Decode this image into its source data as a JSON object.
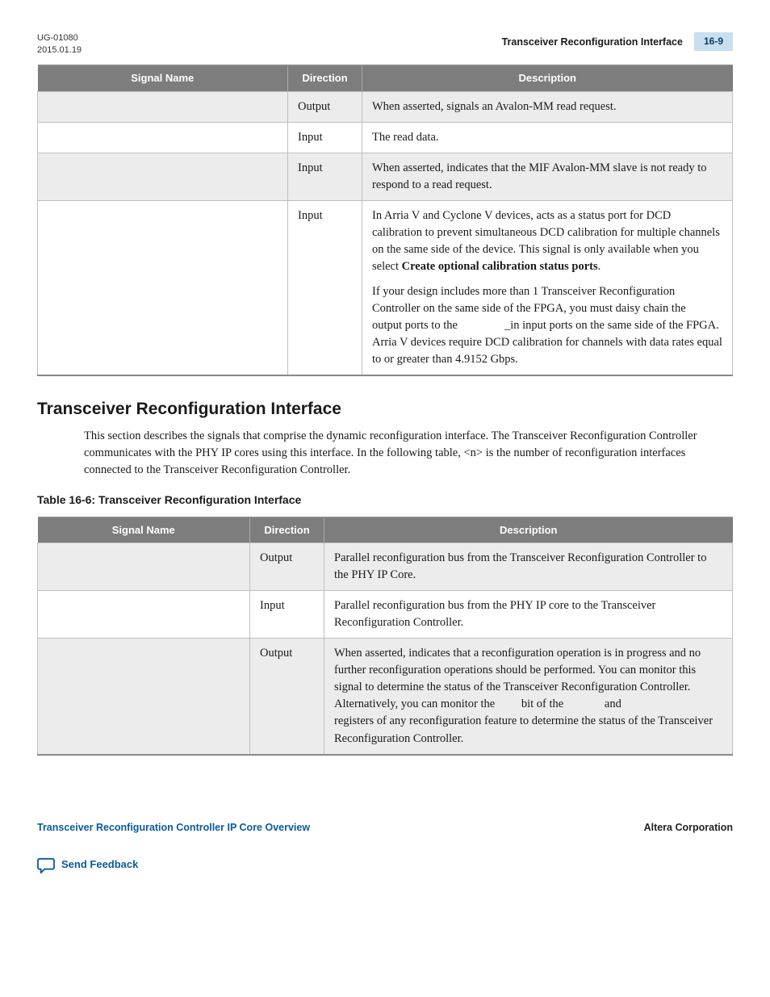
{
  "header": {
    "doc_id": "UG-01080",
    "date": "2015.01.19",
    "crumb": "Transceiver Reconfiguration Interface",
    "page": "16-9"
  },
  "table1": {
    "headers": [
      "Signal Name",
      "Direction",
      "Description"
    ],
    "rows": [
      {
        "signal": "",
        "direction": "Output",
        "description": "When asserted, signals an Avalon-MM read request."
      },
      {
        "signal": "",
        "direction": "Input",
        "description": "The read data."
      },
      {
        "signal": "",
        "direction": "Input",
        "description": "When asserted, indicates that the MIF Avalon-MM slave is not ready to respond to a read request."
      },
      {
        "signal": "",
        "direction": "Input",
        "desc_p1_a": "In Arria V and Cyclone V devices, acts as a status port for DCD calibration to prevent simultaneous DCD calibration for multiple channels on the same side of the device. This signal is only available when you select ",
        "desc_p1_bold": "Create optional calibration status ports",
        "desc_p1_b": ".",
        "desc_p2_a": "If your design includes more than 1 Transceiver Reconfiguration Controller on the same side of the FPGA, you must daisy chain the",
        "desc_p2_b": "output ports to the",
        "desc_p2_c": "_in input ports on the same side of the FPGA. Arria V devices require DCD calibration for channels with data rates equal to or greater than 4.9152 Gbps."
      }
    ]
  },
  "section": {
    "title": "Transceiver Reconfiguration Interface",
    "body": "This section describes the signals that comprise the dynamic reconfiguration interface. The Transceiver Reconfiguration Controller communicates with the PHY IP cores using this interface. In the following table, <n> is the number of reconfiguration interfaces connected to the Transceiver Reconfiguration Controller."
  },
  "table2": {
    "caption": "Table 16-6: Transceiver Reconfiguration Interface",
    "headers": [
      "Signal Name",
      "Direction",
      "Description"
    ],
    "rows": [
      {
        "signal": "",
        "direction": "Output",
        "description": "Parallel reconfiguration bus from the Transceiver Reconfiguration Controller to the PHY IP Core."
      },
      {
        "signal": "",
        "direction": "Input",
        "description": "Parallel reconfiguration bus from the PHY IP core to the Transceiver Reconfiguration Controller."
      },
      {
        "signal": "",
        "direction": "Output",
        "desc_a": "When asserted, indicates that a reconfiguration operation is in progress and no further reconfiguration operations should be performed. You can monitor this signal to determine the status of the Transceiver Reconfiguration Controller. Alternatively, you can monitor the",
        "desc_b": "bit of the",
        "desc_c": "and",
        "desc_d": "registers of any reconfiguration feature to determine the status of the Transceiver Reconfiguration Controller."
      }
    ]
  },
  "footer": {
    "left": "Transceiver Reconfiguration Controller IP Core Overview",
    "right": "Altera Corporation",
    "feedback": "Send Feedback"
  }
}
